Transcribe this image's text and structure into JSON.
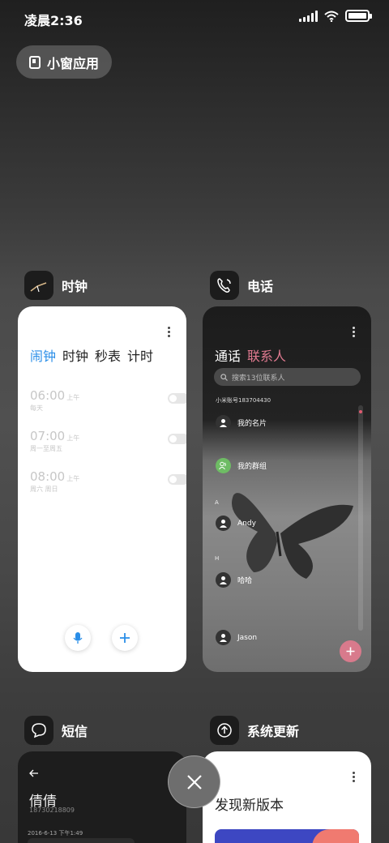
{
  "status_bar": {
    "time": "凌晨2:36",
    "battery_level": 1.0
  },
  "floating_window_button": {
    "label": "小窗应用",
    "icon": "window-icon"
  },
  "apps": {
    "clock": {
      "name": "时钟",
      "icon": "clock-hands-icon",
      "tabs": [
        "闹钟",
        "时钟",
        "秒表",
        "计时"
      ],
      "active_tab": "闹钟",
      "alarms": [
        {
          "time": "06:00",
          "ampm": "上午",
          "repeat": "每天",
          "enabled": false
        },
        {
          "time": "07:00",
          "ampm": "上午",
          "repeat": "周一至周五",
          "enabled": false
        },
        {
          "time": "08:00",
          "ampm": "上午",
          "repeat": "周六 周日",
          "enabled": false
        }
      ],
      "mic_icon": "microphone-icon",
      "add_icon": "plus-icon",
      "accent": "#2a8ee8"
    },
    "phone": {
      "name": "电话",
      "icon": "phone-icon",
      "tabs": [
        "通话",
        "联系人"
      ],
      "active_tab": "联系人",
      "search_placeholder": "搜索13位联系人",
      "account": "小米账号183704430",
      "contacts": [
        "我的名片",
        "我的群组",
        "Andy",
        "哈哈",
        "Jason"
      ],
      "sections": [
        "A",
        "H"
      ],
      "accent": "#e07a90"
    },
    "sms": {
      "name": "短信",
      "icon": "message-bubble-icon",
      "contact_name": "倩倩",
      "contact_number": "18730218809",
      "date": "2016-6-13 下午1:49"
    },
    "update": {
      "name": "系统更新",
      "icon": "upload-arrow-icon",
      "title": "发现新版本"
    }
  },
  "close_button": {
    "icon": "close-icon"
  }
}
